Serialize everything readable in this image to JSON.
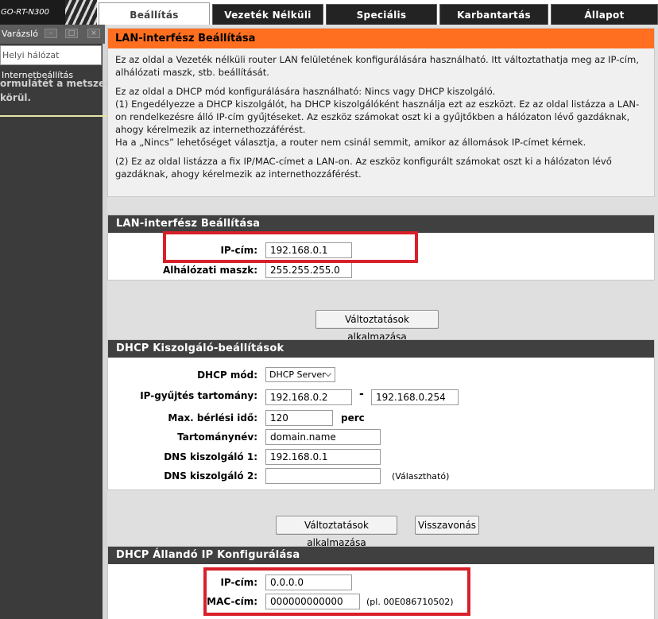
{
  "header": {
    "logo_text": "GO-RT-N300",
    "tabs": [
      {
        "label": "Beállítás",
        "active": true
      },
      {
        "label": "Vezeték Nélküli",
        "active": false
      },
      {
        "label": "Speciális",
        "active": false
      },
      {
        "label": "Karbantartás",
        "active": false
      },
      {
        "label": "Állapot",
        "active": false
      }
    ]
  },
  "sidebar": {
    "wizard_title": "Varázsló",
    "input_text": "Helyi hálózat",
    "link_internet": "Internetbeállítás",
    "overlay_line1": "ormulátét a metszeni",
    "overlay_line2": "körül."
  },
  "intro": {
    "title": "LAN-interfész Beállítása",
    "p1": "Ez az oldal a Vezeték nélküli router LAN felületének konfigurálására használható. Itt változtathatja meg az IP-cím, alhálózati maszk, stb. beállítását.",
    "p2_line1": "Ez az oldal a DHCP mód konfigurálására használható: Nincs vagy DHCP kiszolgáló.",
    "p2_line2": "(1) Engedélyezze a DHCP kiszolgálót, ha DHCP kiszolgálóként használja ezt az eszközt. Ez az oldal listázza a LAN-on rendelkezésre álló IP-cím gyűjtéseket. Az eszköz számokat oszt ki a gyűjtőkben a hálózaton lévő gazdáknak, ahogy kérelmezik az internethozzáférést.",
    "p2_line3": "Ha a „Nincs” lehetőséget választja, a router nem csinál semmit, amikor az állomások IP-címet kérnek.",
    "p3": "(2) Ez az oldal listázza a fix IP/MAC-címet a LAN-on. Az eszköz konfigurált számokat oszt ki a hálózaton lévő gazdáknak, ahogy kérelmezik az internethozzáférést."
  },
  "lan": {
    "title": "LAN-interfész Beállítása",
    "ip_label": "IP-cím:",
    "ip_value": "192.168.0.1",
    "mask_label": "Alhálózati maszk:",
    "mask_value": "255.255.255.0",
    "apply_label": "Változtatások alkalmazása"
  },
  "dhcp": {
    "title": "DHCP Kiszolgáló-beállítások",
    "mode_label": "DHCP mód:",
    "mode_value": "DHCP Server",
    "range_label": "IP-gyűjtés tartomány:",
    "range_start": "192.168.0.2",
    "range_sep": "-",
    "range_end": "192.168.0.254",
    "lease_label": "Max. bérlési idő:",
    "lease_value": "120",
    "lease_unit": "perc",
    "domain_label": "Tartománynév:",
    "domain_value": "domain.name",
    "dns1_label": "DNS kiszolgáló 1:",
    "dns1_value": "192.168.0.1",
    "dns2_label": "DNS kiszolgáló 2:",
    "dns2_value": "",
    "dns2_hint": "(Választható)",
    "apply_label": "Változtatások alkalmazása",
    "cancel_label": "Visszavonás"
  },
  "static": {
    "title": "DHCP Állandó IP Konfigurálása",
    "ip_label": "IP-cím:",
    "ip_value": "0.0.0.0",
    "mac_label": "MAC-cím:",
    "mac_value": "000000000000",
    "mac_hint": "(pl. 00E086710502)"
  },
  "colors": {
    "accent_orange": "#ff6f1f",
    "panel_header": "#404040",
    "highlight_red": "#d8202a"
  }
}
